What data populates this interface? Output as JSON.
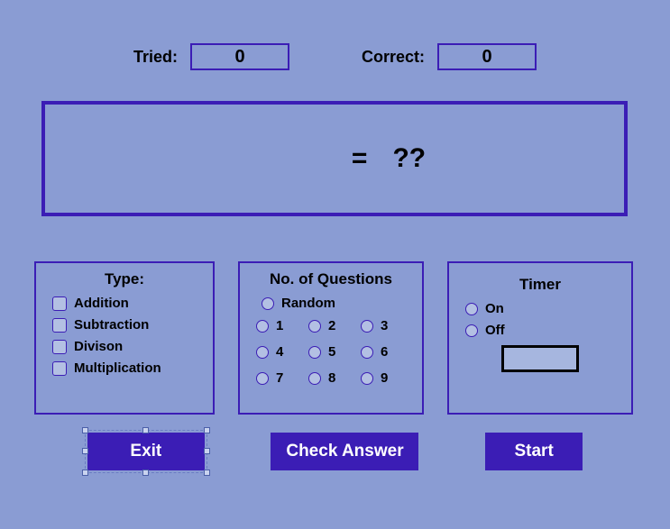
{
  "scores": {
    "tried_label": "Tried:",
    "tried_value": "0",
    "correct_label": "Correct:",
    "correct_value": "0"
  },
  "question": {
    "equals": "=",
    "placeholder": "??"
  },
  "type_panel": {
    "title": "Type:",
    "options": [
      "Addition",
      "Subtraction",
      "Divison",
      "Multiplication"
    ]
  },
  "noq_panel": {
    "title": "No. of Questions",
    "random_label": "Random",
    "numbers": [
      "1",
      "2",
      "3",
      "4",
      "5",
      "6",
      "7",
      "8",
      "9"
    ]
  },
  "timer_panel": {
    "title": "Timer",
    "on_label": "On",
    "off_label": "Off"
  },
  "buttons": {
    "exit": "Exit",
    "check": "Check Answer",
    "start": "Start"
  }
}
